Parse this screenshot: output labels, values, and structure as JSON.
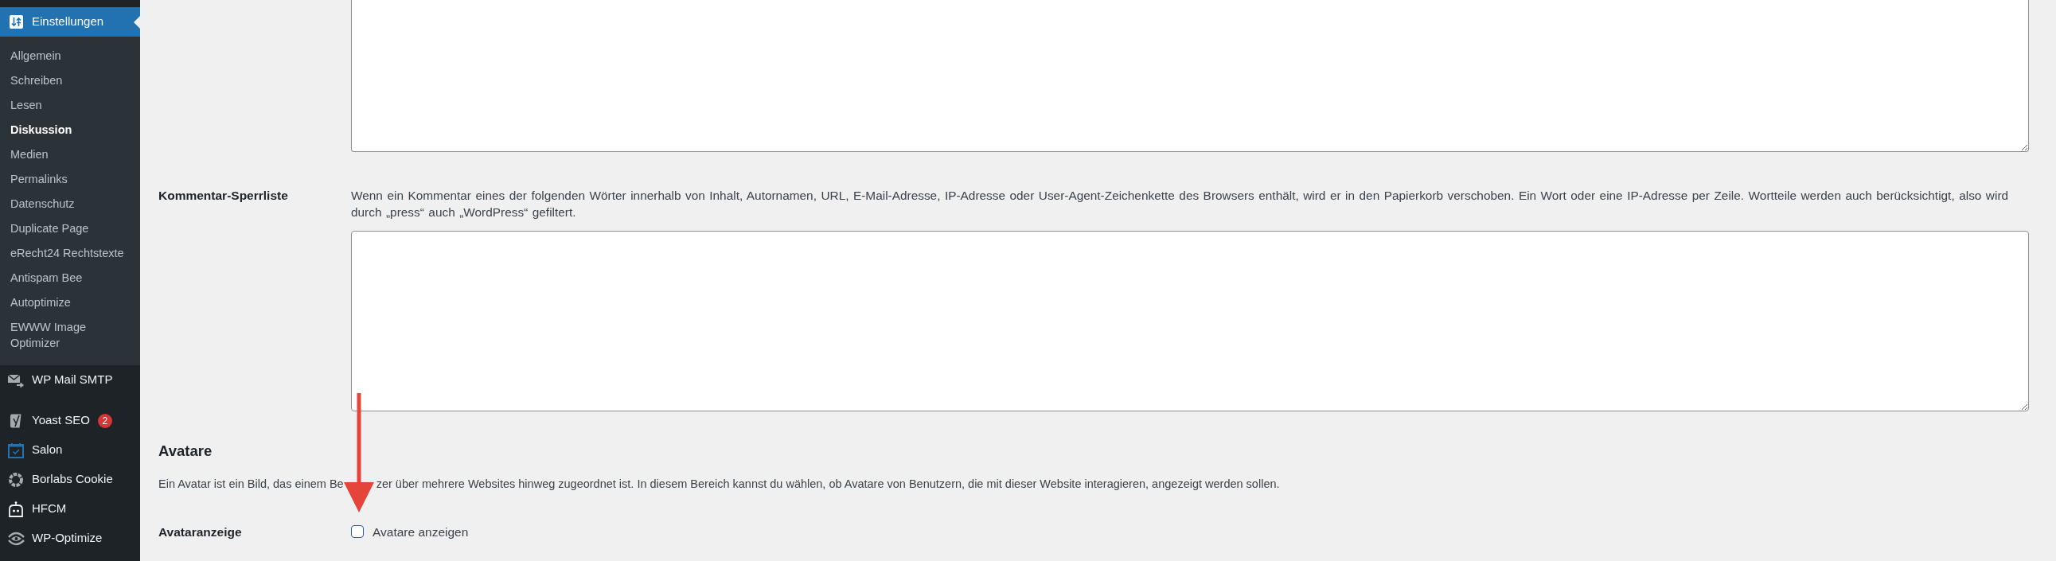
{
  "sidebar": {
    "current": {
      "label": "Einstellungen",
      "selected": true
    },
    "submenu": [
      {
        "label": "Allgemein",
        "selected": false
      },
      {
        "label": "Schreiben",
        "selected": false
      },
      {
        "label": "Lesen",
        "selected": false
      },
      {
        "label": "Diskussion",
        "selected": true
      },
      {
        "label": "Medien",
        "selected": false
      },
      {
        "label": "Permalinks",
        "selected": false
      },
      {
        "label": "Datenschutz",
        "selected": false
      },
      {
        "label": "Duplicate Page",
        "selected": false
      },
      {
        "label": "eRecht24 Rechtstexte",
        "selected": false
      },
      {
        "label": "Antispam Bee",
        "selected": false
      },
      {
        "label": "Autoptimize",
        "selected": false
      },
      {
        "label": "EWWW Image Optimizer",
        "selected": false
      }
    ],
    "menu_groups": [
      [
        {
          "label": "WP Mail SMTP"
        }
      ],
      [
        {
          "label": "Yoast SEO",
          "badge": "2"
        },
        {
          "label": "Salon"
        },
        {
          "label": "Borlabs Cookie"
        },
        {
          "label": "HFCM"
        },
        {
          "label": "WP-Optimize"
        }
      ]
    ]
  },
  "blocklist": {
    "label": "Kommentar-Sperrliste",
    "description": "Wenn ein Kommentar eines der folgenden Wörter innerhalb von Inhalt, Autornamen, URL, E-Mail-Adresse, IP-Adresse oder User-Agent-Zeichenkette des Browsers enthält, wird er in den Papierkorb verschoben. Ein Wort oder eine IP-Adresse per Zeile. Wortteile werden auch berücksichtigt, also wird durch „press“ auch „WordPress“ gefiltert."
  },
  "avatars": {
    "heading": "Avatare",
    "description_parts": [
      "Ein Avatar ist ein Bild, das einem Be",
      "zer über mehrere Websites hinweg zugeordnet ist. In diesem Bereich kannst du wählen, ob Avatare von Benutzern, die mit dieser Website interagieren, angezeigt werden sollen."
    ],
    "display": {
      "label": "Avataranzeige",
      "option": "Avatare anzeigen",
      "checked": false
    }
  }
}
